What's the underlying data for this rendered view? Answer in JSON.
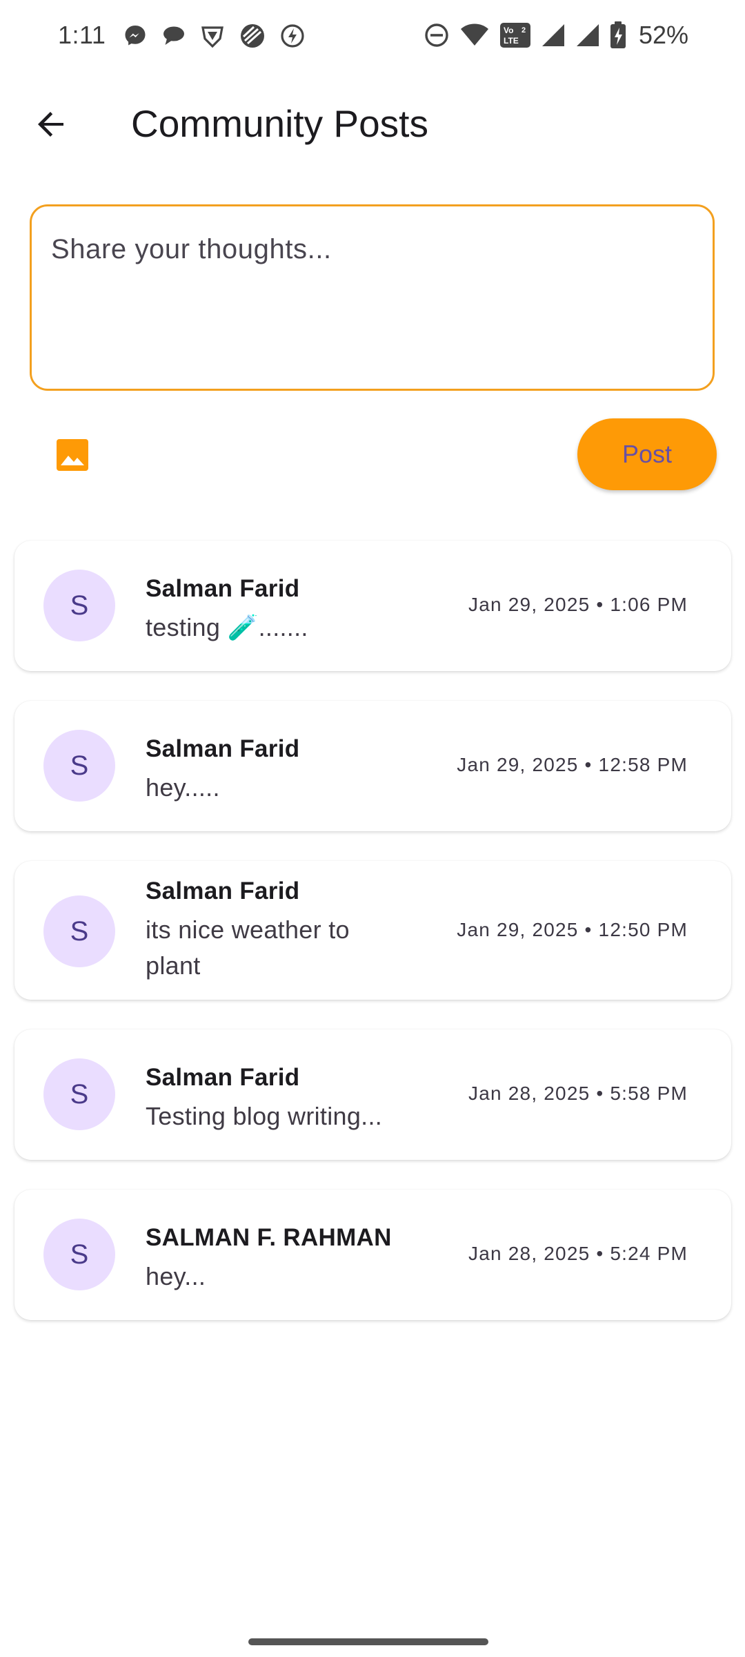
{
  "status_bar": {
    "time": "1:11",
    "notification_icons": [
      "messenger-icon",
      "chat-bubble-icon",
      "vpn-shield-icon",
      "app-swirl-icon",
      "bolt-icon"
    ],
    "system_icons": [
      "do-not-disturb-icon",
      "wifi-icon",
      "volte-icon",
      "signal-icon",
      "signal-icon",
      "battery-charging-icon"
    ],
    "volte_label": "Vo LTE 2",
    "battery": "52%"
  },
  "app_bar": {
    "title": "Community Posts",
    "back_icon": "arrow-back-icon"
  },
  "composer": {
    "placeholder": "Share your thoughts...",
    "value": "",
    "image_icon": "image-icon",
    "post_label": "Post"
  },
  "posts": [
    {
      "avatar_letter": "S",
      "author": "Salman Farid",
      "body": "testing 🧪.......",
      "time": "Jan 29, 2025 • 1:06 PM"
    },
    {
      "avatar_letter": "S",
      "author": "Salman Farid",
      "body": "hey.....",
      "time": "Jan 29, 2025 • 12:58 PM"
    },
    {
      "avatar_letter": "S",
      "author": "Salman Farid",
      "body": "its nice weather to plant",
      "time": "Jan 29, 2025 • 12:50 PM"
    },
    {
      "avatar_letter": "S",
      "author": "Salman Farid",
      "body": "Testing blog writing...",
      "time": "Jan 28, 2025 • 5:58 PM"
    },
    {
      "avatar_letter": "S",
      "author": "SALMAN F. RAHMAN",
      "body": "hey...",
      "time": "Jan 28, 2025 • 5:24 PM"
    }
  ],
  "colors": {
    "accent_orange": "#fe9a06",
    "composer_border": "#f3a01f",
    "avatar_bg": "#eaddff",
    "avatar_text": "#4a3a8a",
    "post_label_text": "#6750a4"
  }
}
